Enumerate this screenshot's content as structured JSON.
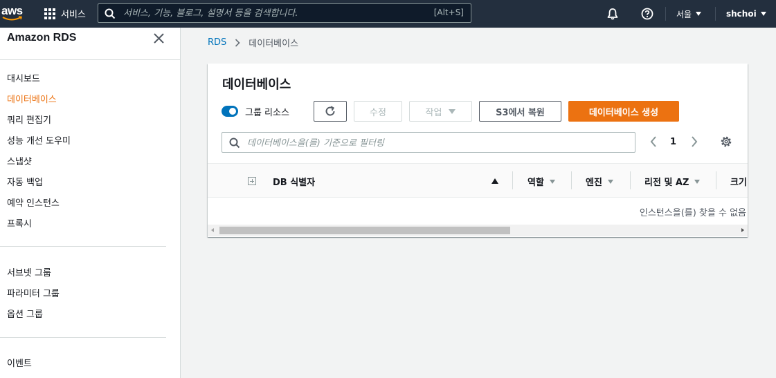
{
  "topnav": {
    "logo_text": "aws",
    "services_label": "서비스",
    "search_placeholder": "서비스, 기능, 블로그, 설명서 등을 검색합니다.",
    "search_shortcut": "[Alt+S]",
    "region_label": "서울",
    "user_label": "shchoi"
  },
  "sidebar": {
    "title": "Amazon RDS",
    "group1": [
      "대시보드",
      "데이터베이스",
      "쿼리 편집기",
      "성능 개선 도우미",
      "스냅샷",
      "자동 백업",
      "예약 인스턴스",
      "프록시"
    ],
    "active_index": 1,
    "group2": [
      "서브넷 그룹",
      "파라미터 그룹",
      "옵션 그룹"
    ],
    "group3": [
      "이벤트"
    ]
  },
  "breadcrumb": {
    "root": "RDS",
    "current": "데이터베이스"
  },
  "panel": {
    "title": "데이터베이스",
    "toggle_label": "그룹 리소스",
    "toggle_on": true,
    "buttons": {
      "modify": "수정",
      "actions": "작업",
      "restore_s3": "S3에서 복원",
      "create": "데이터베이스 생성"
    },
    "filter_placeholder": "데이터베이스을(를) 기준으로 필터링",
    "page_number": "1",
    "columns": {
      "identifier": "DB 식별자",
      "role": "역할",
      "engine": "엔진",
      "region_az": "리전 및 AZ",
      "size": "크기"
    },
    "empty_message": "인스턴스을(를) 찾을 수 없음"
  },
  "colors": {
    "nav_bg": "#232f3e",
    "accent_orange": "#ec7211",
    "link_blue": "#0073bb"
  }
}
